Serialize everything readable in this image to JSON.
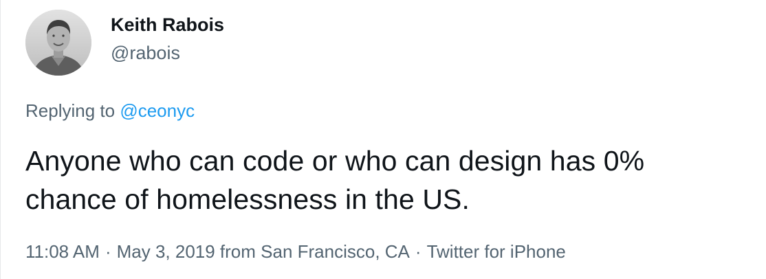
{
  "author": {
    "display_name": "Keith Rabois",
    "handle": "@rabois",
    "avatar_icon": "user-avatar-photo"
  },
  "reply": {
    "prefix": "Replying to ",
    "mention": "@ceonyc"
  },
  "tweet": {
    "line1": "Anyone who can code or who can design has 0%",
    "line2": "chance of homelessness in the US."
  },
  "meta": {
    "time": "11:08 AM",
    "separator": "·",
    "date_location": "May 3, 2019 from San Francisco, CA",
    "source": "Twitter for iPhone"
  },
  "colors": {
    "text": "#0f1419",
    "muted": "#536471",
    "link": "#1d9bf0"
  }
}
